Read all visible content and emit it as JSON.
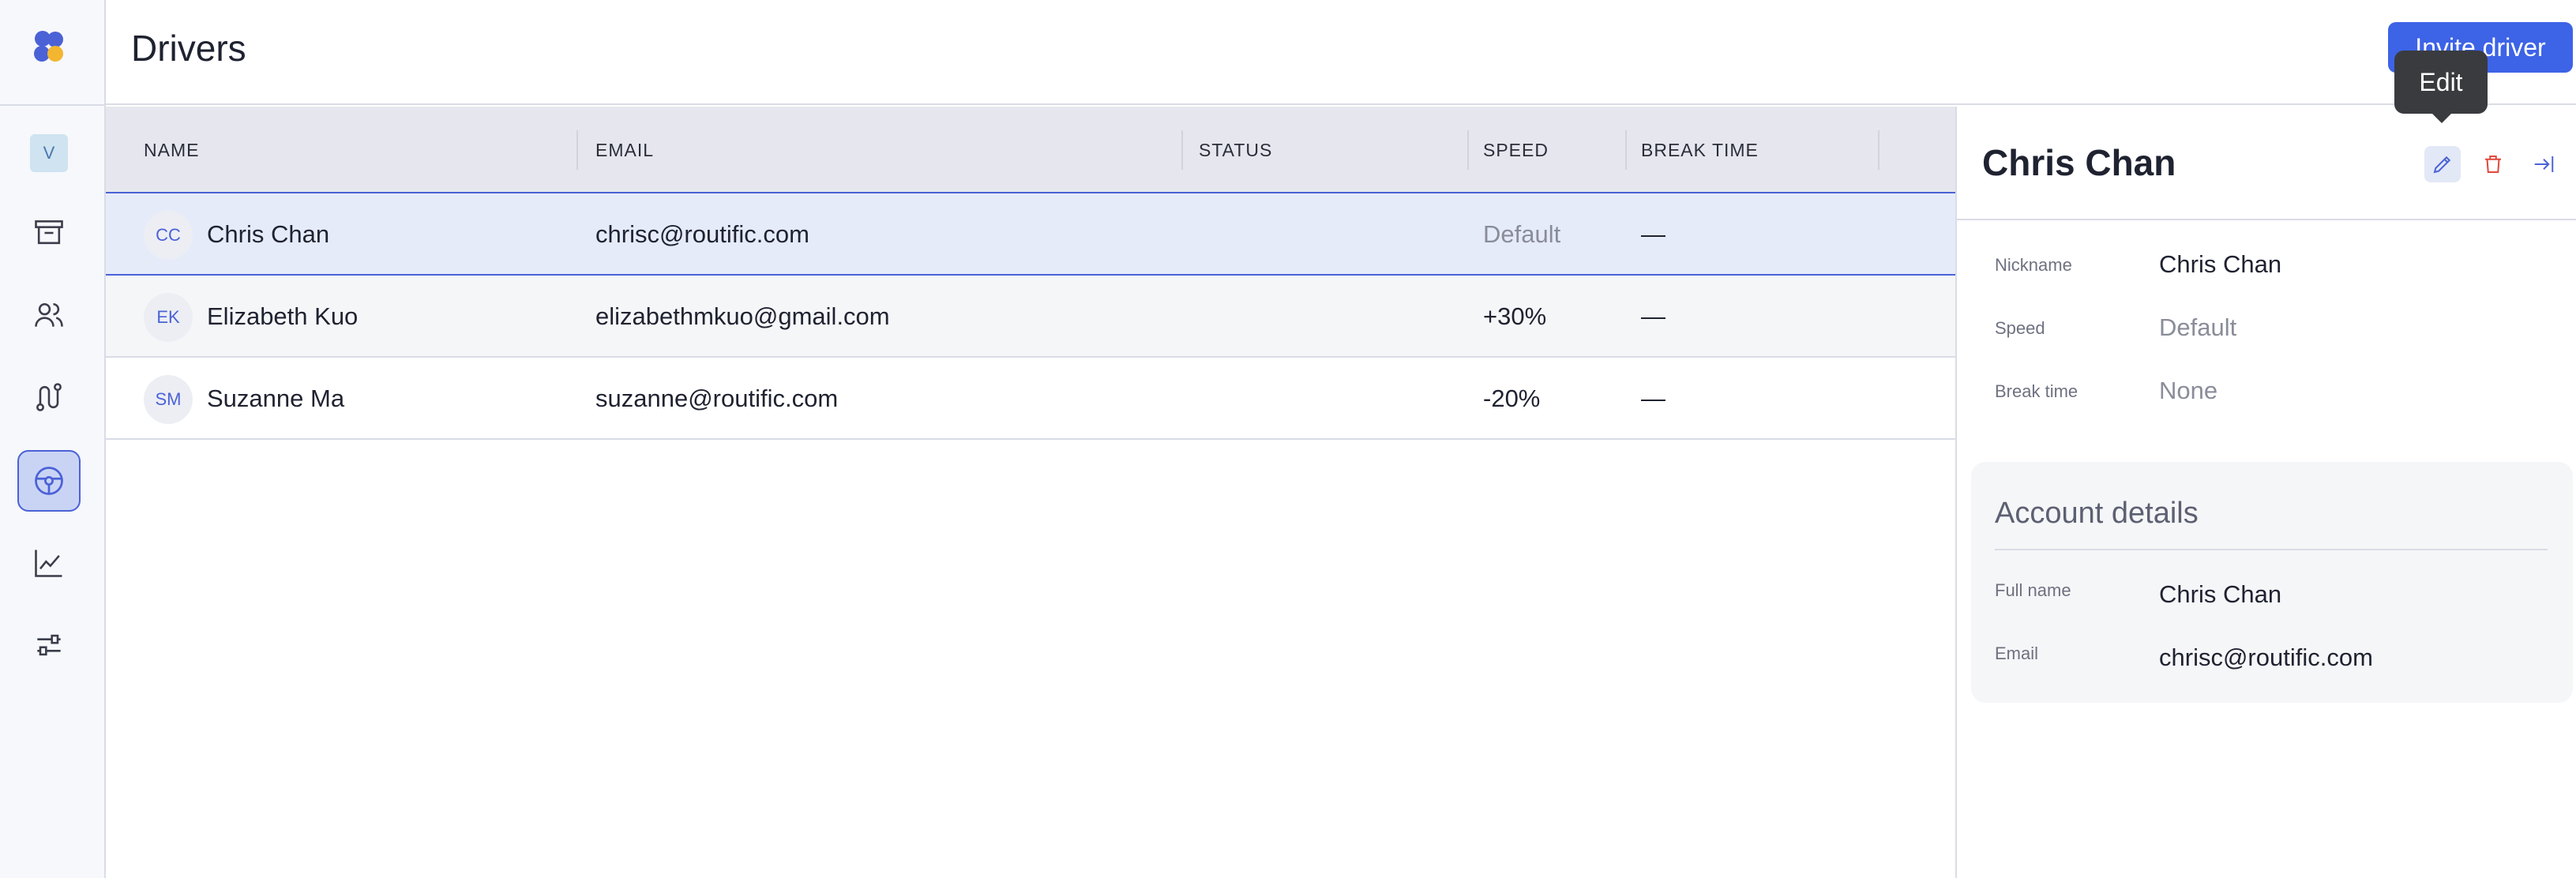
{
  "rail": {
    "avatar_letter": "V",
    "nav": [
      {
        "icon": "archive-icon"
      },
      {
        "icon": "users-icon"
      },
      {
        "icon": "route-icon"
      },
      {
        "icon": "steering-wheel-icon",
        "active": true
      },
      {
        "icon": "chart-line-icon"
      },
      {
        "icon": "sliders-icon"
      }
    ],
    "logo_colors": [
      "#4b62d6",
      "#f2b630"
    ]
  },
  "header": {
    "title": "Drivers",
    "invite_label": "Invite driver"
  },
  "table": {
    "columns": [
      "NAME",
      "EMAIL",
      "STATUS",
      "SPEED",
      "BREAK TIME"
    ],
    "rows": [
      {
        "initials": "CC",
        "name": "Chris Chan",
        "email": "chrisc@routific.com",
        "status": "",
        "speed": "Default",
        "break_time": "—",
        "selected": true
      },
      {
        "initials": "EK",
        "name": "Elizabeth Kuo",
        "email": "elizabethmkuo@gmail.com",
        "status": "",
        "speed": "+30%",
        "break_time": "—"
      },
      {
        "initials": "SM",
        "name": "Suzanne Ma",
        "email": "suzanne@routific.com",
        "status": "",
        "speed": "-20%",
        "break_time": "—"
      }
    ]
  },
  "panel": {
    "title": "Chris Chan",
    "tooltip": "Edit",
    "fields": {
      "nickname_label": "Nickname",
      "nickname_value": "Chris Chan",
      "speed_label": "Speed",
      "speed_value": "Default",
      "break_label": "Break time",
      "break_value": "None"
    },
    "account": {
      "title": "Account details",
      "fullname_label": "Full name",
      "fullname_value": "Chris Chan",
      "email_label": "Email",
      "email_value": "chrisc@routific.com"
    }
  },
  "colors": {
    "accent": "#3d63e6",
    "delete": "#e0483b"
  }
}
